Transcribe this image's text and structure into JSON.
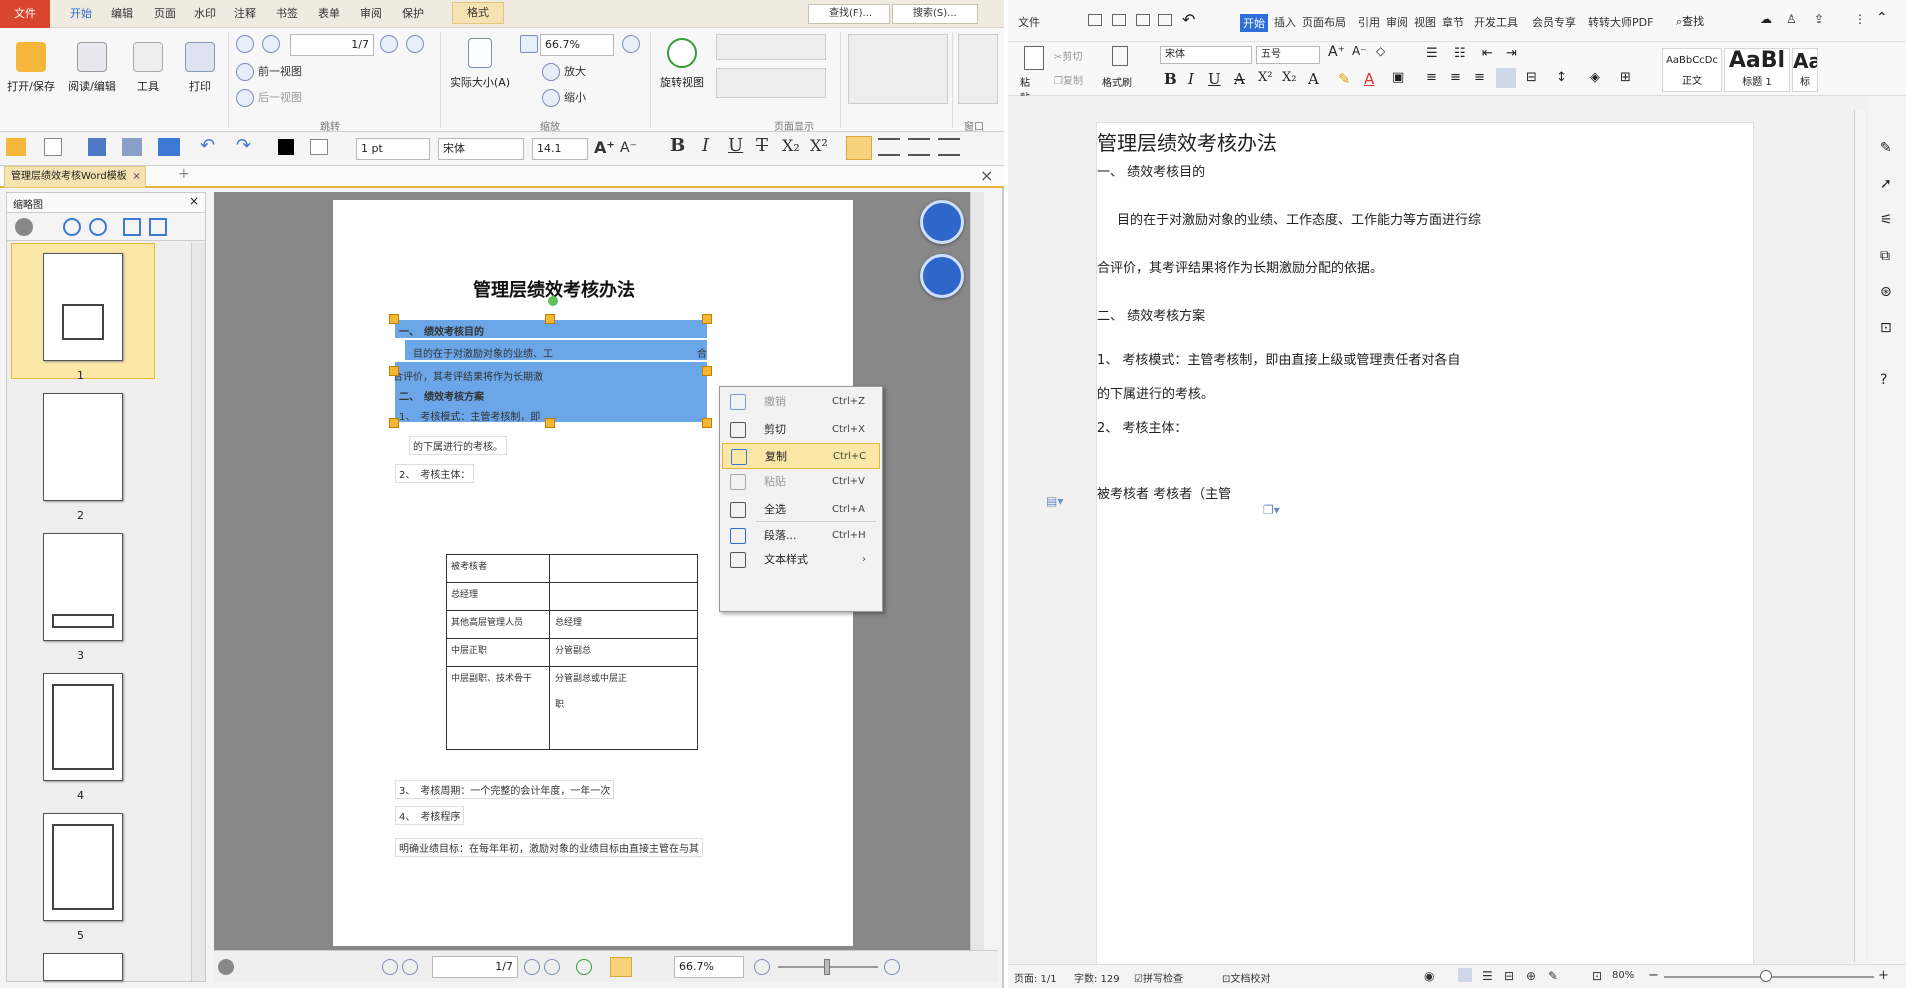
{
  "left_app": {
    "menu": {
      "file": "文件",
      "home": "开始",
      "edit": "编辑",
      "page": "页面",
      "watermark": "水印",
      "annotate": "注释",
      "bookmark": "书签",
      "form": "表单",
      "review": "审阅",
      "protect": "保护",
      "format": "格式",
      "find": "查找(F)...",
      "search": "搜索(S)..."
    },
    "ribbon": {
      "open_save": "打开/保存",
      "read_edit": "阅读/编辑",
      "tools": "工具",
      "print": "打印",
      "page_input": "1/7",
      "prev_view": "前一视图",
      "next_view": "后一视图",
      "zoom_value": "66.7%",
      "zoom_in": "放大",
      "zoom_out": "缩小",
      "actual_size": "实际大小(A)",
      "rotate_view": "旋转视图",
      "group_jump": "跳转",
      "group_zoom": "缩放",
      "group_page_display": "页面显示",
      "group_window": "窗口"
    },
    "format_bar": {
      "stroke": "1 pt",
      "font": "宋体",
      "size": "14.1"
    },
    "doc_tab": "管理层绩效考核Word模板",
    "thumb_panel_title": "缩略图",
    "thumb_numbers": [
      "1",
      "2",
      "3",
      "4",
      "5"
    ],
    "page": {
      "title": "管理层绩效考核办法",
      "line1": "一、　绩效考核目的",
      "line2": "目的在于对激励对象的业绩、工",
      "line2b": "合",
      "line3": "合评价，其考评结果将作为长期激",
      "line4": "二、　绩效考核方案",
      "line5": "1、　考核模式：主管考核制，即",
      "line6": "的下属进行的考核。",
      "line7": "2、　考核主体：",
      "table": [
        [
          "被考核者",
          ""
        ],
        [
          "总经理",
          ""
        ],
        [
          "其他高层管理人员",
          "总经理"
        ],
        [
          "中层正职",
          "分管副总"
        ],
        [
          "中层副职、技术骨干",
          "分管副总或中层正"
        ],
        [
          "",
          "职"
        ]
      ],
      "line8": "3、　考核周期：一个完整的会计年度，一年一次",
      "line9": "4、　考核程序",
      "line10": "明确业绩目标：在每年年初，激励对象的业绩目标由直接主管在与其"
    },
    "context_menu": [
      {
        "label": "撤销",
        "shortcut": "Ctrl+Z",
        "icon": "undo-icon",
        "disabled": true
      },
      {
        "label": "剪切",
        "shortcut": "Ctrl+X",
        "icon": "scissors-icon",
        "disabled": false
      },
      {
        "label": "复制",
        "shortcut": "Ctrl+C",
        "icon": "copy-icon",
        "disabled": false,
        "highlighted": true
      },
      {
        "label": "粘贴",
        "shortcut": "Ctrl+V",
        "icon": "paste-icon",
        "disabled": true
      },
      {
        "label": "全选",
        "shortcut": "Ctrl+A",
        "icon": "select-all-icon",
        "disabled": false
      },
      {
        "label": "段落...",
        "shortcut": "Ctrl+H",
        "icon": "paragraph-icon",
        "disabled": false
      },
      {
        "label": "文本样式",
        "shortcut": "›",
        "icon": "text-style-icon",
        "disabled": false
      }
    ],
    "bottom": {
      "page_input": "1/7",
      "zoom": "66.7%"
    }
  },
  "right_app": {
    "menu": [
      "文件",
      "开始",
      "插入",
      "页面布局",
      "引用",
      "审阅",
      "视图",
      "章节",
      "开发工具",
      "会员专享",
      "转转大师PDF"
    ],
    "search": "查找",
    "ribbon": {
      "paste": "粘贴",
      "cut": "剪切",
      "copy": "复制",
      "format_painter": "格式刷",
      "font": "宋体",
      "size": "五号",
      "style1_preview": "AaBbCcDc",
      "style1_name": "正文",
      "style2_preview": "AaBl",
      "style2_name": "标题 1",
      "style3_preview": "Aa",
      "style3_name": "标"
    },
    "doc": {
      "title": "管理层绩效考核办法",
      "p1": "一、 绩效考核目的",
      "p2": "目的在于对激励对象的业绩、工作态度、工作能力等方面进行综",
      "p3": "合评价，其考评结果将作为长期激励分配的依据。",
      "p4": "二、 绩效考核方案",
      "p5": "1、 考核模式：主管考核制，即由直接上级或管理责任者对各自",
      "p6": "的下属进行的考核。",
      "p7": "2、 考核主体：",
      "p8": "被考核者  考核者（主管"
    },
    "status": {
      "page": "页面: 1/1",
      "words": "字数: 129",
      "spell": "拼写检查",
      "proof": "文档校对",
      "zoom": "80%"
    }
  }
}
